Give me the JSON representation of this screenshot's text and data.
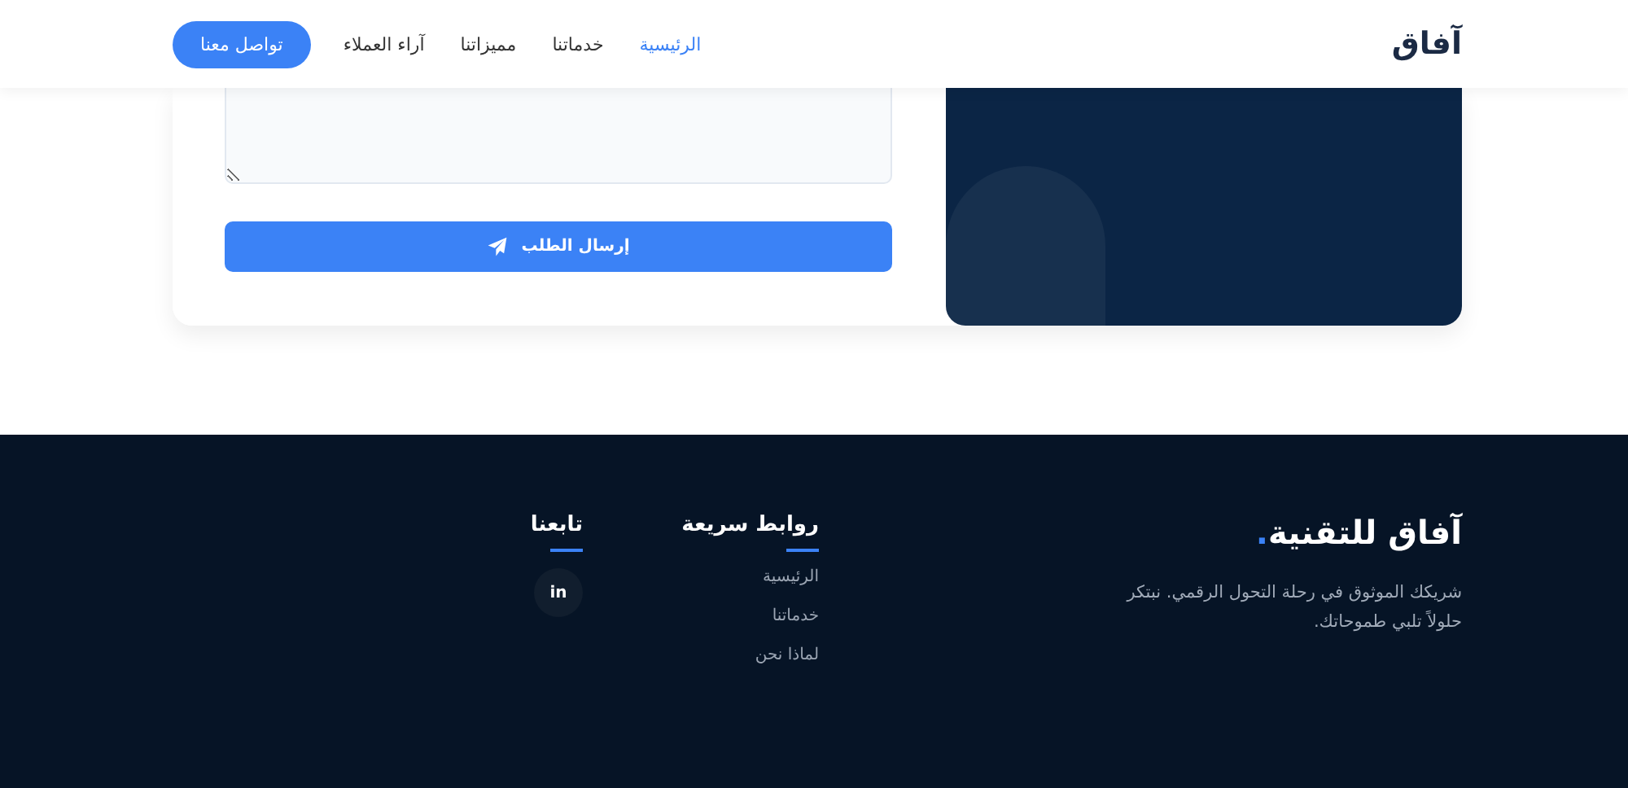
{
  "header": {
    "logo": "آفاق",
    "nav": [
      {
        "label": "الرئيسية",
        "selected": true
      },
      {
        "label": "خدماتنا",
        "selected": false
      },
      {
        "label": "مميزاتنا",
        "selected": false
      },
      {
        "label": "آراء العملاء",
        "selected": false
      }
    ],
    "cta": "تواصل معنا"
  },
  "form": {
    "submit": "إرسال الطلب"
  },
  "footer": {
    "brand": {
      "title": "آفاق للتقنية",
      "title_mark": ".",
      "text": "شريكك الموثوق في رحلة التحول الرقمي. نبتكر حلولاً تلبي طموحاتك."
    },
    "links": {
      "heading": "روابط سريعة",
      "items": [
        "الرئيسية",
        "خدماتنا",
        "لماذا نحن"
      ]
    },
    "social": {
      "heading": "تابعنا",
      "items": [
        "in"
      ]
    }
  }
}
